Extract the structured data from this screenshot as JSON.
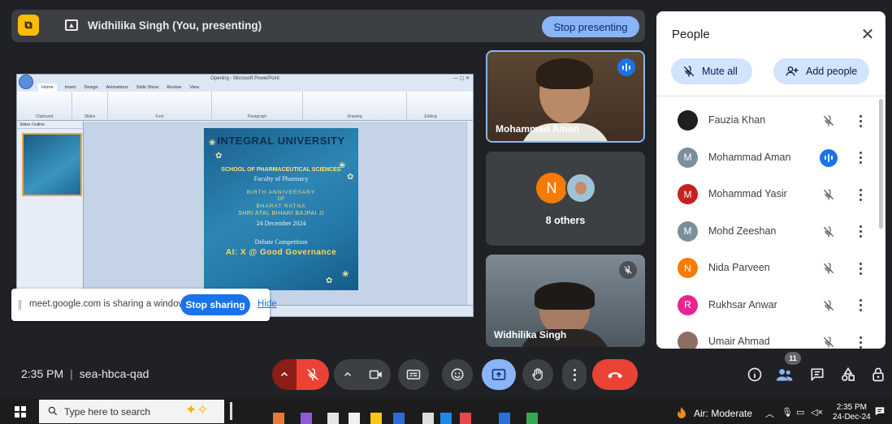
{
  "presenting_bar": {
    "badge_icon": "presentation-lock-icon",
    "title": "Widhilika Singh (You, presenting)",
    "stop_label": "Stop presenting"
  },
  "shared_window": {
    "app_title": "Opening - Microsoft PowerPoint",
    "tabs": [
      "Home",
      "Insert",
      "Design",
      "Animations",
      "Slide Show",
      "Review",
      "View"
    ],
    "ribbon_groups": [
      "Clipboard",
      "Slides",
      "Font",
      "Paragraph",
      "Drawing",
      "Editing"
    ],
    "panel_tabs": "Slides   Outline",
    "slide": {
      "logo": "INTEGRAL UNIVERSITY",
      "school": "SCHOOL OF PHARMACEUTICAL SCIENCES",
      "faculty": "Faculty of Pharmacy",
      "birth": "BIRTH ANNIVERSARY",
      "of": "OF",
      "bharat": "BHARAT RATNA",
      "shri": "SHRI ATAL BIHARI BAJPAI JI",
      "date": "24 December 2024",
      "debate": "Debate Competition",
      "topic": "AI: X @ Good Governance"
    }
  },
  "share_notice": {
    "text": "meet.google.com is sharing a window.",
    "stop_label": "Stop sharing",
    "hide_label": "Hide"
  },
  "tiles": {
    "aman": {
      "name": "Mohammad Aman"
    },
    "others": {
      "label": "8 others",
      "initial": "N"
    },
    "widhilika": {
      "name": "Widhilika Singh"
    }
  },
  "people_panel": {
    "title": "People",
    "mute_all": "Mute all",
    "add_people": "Add people",
    "participants": [
      {
        "name": "Fauzia Khan",
        "initial": "",
        "color": "#1f1f1f",
        "mic": "muted"
      },
      {
        "name": "Mohammad Aman",
        "initial": "M",
        "color": "#78909c",
        "mic": "speaking"
      },
      {
        "name": "Mohammad Yasir",
        "initial": "M",
        "color": "#c5221f",
        "mic": "muted"
      },
      {
        "name": "Mohd Zeeshan",
        "initial": "M",
        "color": "#78909c",
        "mic": "muted"
      },
      {
        "name": "Nida Parveen",
        "initial": "N",
        "color": "#f57c00",
        "mic": "muted"
      },
      {
        "name": "Rukhsar Anwar",
        "initial": "R",
        "color": "#e52592",
        "mic": "muted"
      },
      {
        "name": "Umair Ahmad",
        "initial": "",
        "color": "#8d6e63",
        "mic": "muted"
      }
    ]
  },
  "controls": {
    "time": "2:35 PM",
    "meeting_code": "sea-hbca-qad",
    "participant_count": "11"
  },
  "taskbar": {
    "search_placeholder": "Type here to search",
    "weather": "Air: Moderate",
    "time": "2:35 PM",
    "date": "24-Dec-24"
  }
}
